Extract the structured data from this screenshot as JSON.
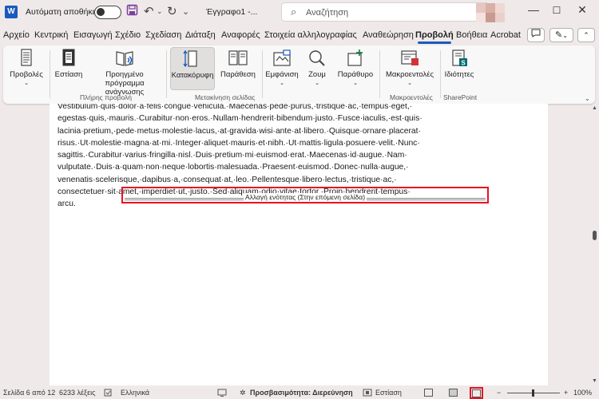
{
  "titlebar": {
    "app_icon": "word-logo",
    "app_letter": "W",
    "autosave_label": "Αυτόματη αποθήκευση",
    "autosave_state": "off",
    "document_title": "Έγγραφο1  -...",
    "search_placeholder": "Αναζήτηση",
    "window_controls": [
      "minimize-icon",
      "maximize-icon",
      "close-icon"
    ]
  },
  "menu": {
    "tabs": [
      "Αρχείο",
      "Κεντρική",
      "Εισαγωγή",
      "Σχέδιο",
      "Σχεδίαση",
      "Διάταξη",
      "Αναφορές",
      "Στοιχεία αλληλογραφίας",
      "Αναθεώρηση",
      "Προβολή",
      "Βοήθεια",
      "Acrobat"
    ],
    "active_tab": "Προβολή"
  },
  "ribbon": {
    "groups": [
      {
        "label": "",
        "buttons": [
          {
            "label": "Προβολές",
            "icon": "views-icon",
            "dropdown": true
          }
        ]
      },
      {
        "label": "Πλήρης προβολή",
        "buttons": [
          {
            "label": "Εστίαση",
            "icon": "focus-icon"
          },
          {
            "label": "Προηγμένο πρόγραμμα ανάγνωσης",
            "icon": "immersive-reader-icon"
          }
        ]
      },
      {
        "label": "Μετακίνηση σελίδας",
        "buttons": [
          {
            "label": "Κατακόρυφη",
            "icon": "vertical-icon",
            "selected": true
          },
          {
            "label": "Παράθεση",
            "icon": "side-to-side-icon"
          }
        ]
      },
      {
        "label": "",
        "buttons": [
          {
            "label": "Εμφάνιση",
            "icon": "show-icon",
            "dropdown": true
          },
          {
            "label": "Ζουμ",
            "icon": "zoom-icon",
            "dropdown": true
          },
          {
            "label": "Παράθυρο",
            "icon": "window-icon",
            "dropdown": true
          }
        ]
      },
      {
        "label": "Μακροεντολές",
        "buttons": [
          {
            "label": "Μακροεντολές",
            "icon": "macros-icon",
            "dropdown": true
          }
        ]
      },
      {
        "label": "SharePoint",
        "buttons": [
          {
            "label": "Ιδιότητες",
            "icon": "properties-icon"
          }
        ]
      }
    ]
  },
  "document": {
    "paragraph_lines": [
      "Vestibulum·quis·dolor·a·felis·congue·vehicula.·Maecenas·pede·purus,·tristique·ac,·tempus·eget,·",
      "egestas·quis,·mauris.·Curabitur·non·eros.·Nullam·hendrerit·bibendum·justo.·Fusce·iaculis,·est·quis·",
      "lacinia·pretium,·pede·metus·molestie·lacus,·at·gravida·wisi·ante·at·libero.·Quisque·ornare·placerat·",
      "risus.·Ut·molestie·magna·at·mi.·Integer·aliquet·mauris·et·nibh.·Ut·mattis·ligula·posuere·velit.·Nunc·",
      "sagittis.·Curabitur·varius·fringilla·nisl.·Duis·pretium·mi·euismod·erat.·Maecenas·id·augue.·Nam·",
      "vulputate.·Duis·a·quam·non·neque·lobortis·malesuada.·Praesent·euismod.·Donec·nulla·augue,·",
      "venenatis·scelerisque,·dapibus·a,·consequat·at,·leo.·Pellentesque·libero·lectus,·tristique·ac,·",
      "consectetuer·sit·amet,·imperdiet·ut,·justo.·Sed·aliquam·odio·vitae·tortor.·Proin·hendrerit·tempus·",
      "arcu."
    ],
    "section_break_label": "Αλλαγή ενότητας (Στην επόμενη σελίδα)",
    "highlight_color": "#e81123"
  },
  "statusbar": {
    "page": "Σελίδα 6 από 12",
    "words": "6233 λέξεις",
    "language": "Ελληνικά",
    "accessibility": "Προσβασιμότητα: Διερεύνηση",
    "focus": "Εστίαση",
    "zoom_minus": "−",
    "zoom_plus": "+",
    "zoom": "100%"
  },
  "colors": {
    "accent": "#185abd",
    "highlight": "#e81123",
    "background": "#efeae9"
  }
}
